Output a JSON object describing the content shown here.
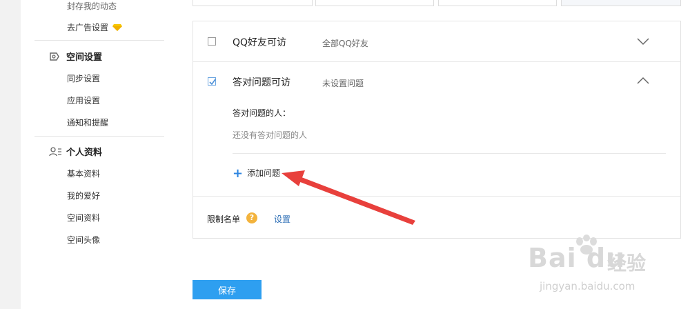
{
  "sidebar": {
    "top_items": [
      {
        "label": "封存我的动态"
      },
      {
        "label": "去广告设置"
      }
    ],
    "sections": [
      {
        "title": "空间设置",
        "icon": "space-settings-icon",
        "items": [
          "同步设置",
          "应用设置",
          "通知和提醒"
        ]
      },
      {
        "title": "个人资料",
        "icon": "profile-icon",
        "items": [
          "基本资料",
          "我的爱好",
          "空间资料",
          "空间头像"
        ]
      }
    ]
  },
  "options": [
    {
      "label": "QQ好友可访",
      "desc": "全部QQ好友",
      "checked": false,
      "expanded": false
    },
    {
      "label": "答对问题可访",
      "desc": "未设置问题",
      "checked": true,
      "expanded": true
    }
  ],
  "question_panel": {
    "title": "答对问题的人：",
    "empty_text": "还没有答对问题的人",
    "add_label": "添加问题"
  },
  "restriction": {
    "label": "限制名单",
    "help_symbol": "?",
    "link_label": "设置"
  },
  "save_label": "保存",
  "watermark": {
    "logo_text": "Bai du",
    "brand_text": "经验",
    "url_text": "jingyan.baidu.com"
  },
  "colors": {
    "accent": "#2e9ff0",
    "link": "#2e6fb6",
    "help_badge": "#f3b33d",
    "annotation_arrow": "#e8403c"
  }
}
